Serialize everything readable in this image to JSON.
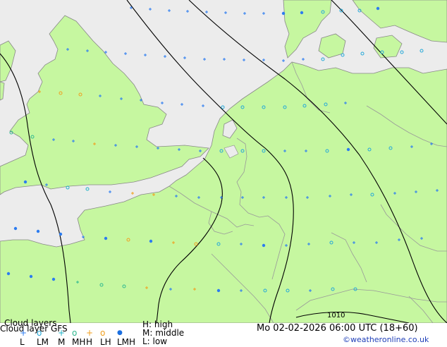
{
  "map": {
    "colors": {
      "sea": "#ececec",
      "land": "#c6f7a0",
      "border": "#999999",
      "coast": "#888888",
      "isobar": "#000000",
      "low_marker": "#2c7cf0",
      "low_mid_marker": "#24a8d8",
      "middle_marker": "#1fb3c7",
      "mid_high_marker": "#2fb88f",
      "high_marker": "#f0a020",
      "low_high_marker": "#f0a020",
      "low_mid_high_marker": "#1b6fe0"
    },
    "isobar_label": "1010"
  },
  "legend": {
    "title": "Cloud layers",
    "model": "Cloud layer GFS",
    "high_label": "H: high",
    "middle_label": "M: middle",
    "low_label": "L: low",
    "symbols": [
      {
        "code": "L",
        "glyph": "+",
        "color": "#2c7cf0"
      },
      {
        "code": "LM",
        "glyph": "o",
        "color": "#24a8d8"
      },
      {
        "code": "M",
        "glyph": "+",
        "color": "#1fb3c7"
      },
      {
        "code": "MH",
        "glyph": "o",
        "color": "#2fb88f"
      },
      {
        "code": "H",
        "glyph": "+",
        "color": "#f0a020"
      },
      {
        "code": "LH",
        "glyph": "o",
        "color": "#f0a020"
      },
      {
        "code": "LMH",
        "glyph": "●",
        "color": "#1b6fe0"
      }
    ]
  },
  "datetime": "Mo 02-02-2026 06:00 UTC (18+60)",
  "credit": "©weatheronline.co.uk"
}
